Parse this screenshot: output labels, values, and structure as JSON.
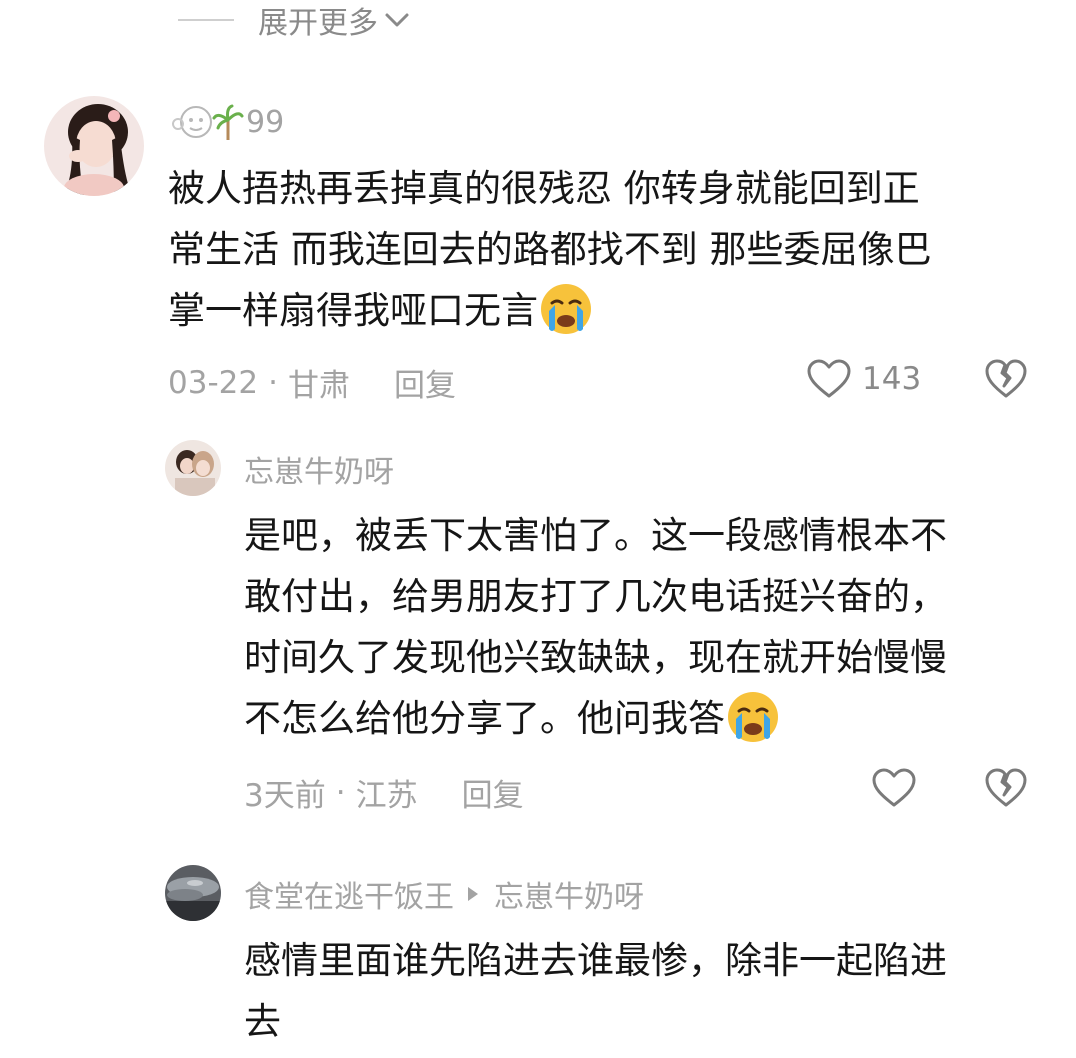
{
  "expand": {
    "label": "展开更多"
  },
  "comments": [
    {
      "username": "99",
      "text_lines": [
        "被人捂热再丢掉真的很残忍 你转身就能回到正",
        "常生活 而我连回去的路都找不到 那些委屈像巴",
        "掌一样扇得我哑口无言"
      ],
      "date": "03-22",
      "location": "甘肃",
      "reply_label": "回复",
      "likes": "143"
    },
    {
      "username": "忘崽牛奶呀",
      "text_lines": [
        "是吧，被丢下太害怕了。这一段感情根本不",
        "敢付出，给男朋友打了几次电话挺兴奋的，",
        "时间久了发现他兴致缺缺，现在就开始慢慢",
        "不怎么给他分享了。他问我答"
      ],
      "date": "3天前",
      "location": "江苏",
      "reply_label": "回复"
    },
    {
      "username": "食堂在逃干饭王",
      "reply_to": "忘崽牛奶呀",
      "text_lines": [
        "感情里面谁先陷进去谁最惨，除非一起陷进",
        "去"
      ]
    }
  ],
  "meta_separator": "·",
  "icons": {
    "chevron": "chevron-down-icon",
    "like": "heart-outline-icon",
    "dislike": "broken-heart-icon",
    "emoji": "crying-face-emoji",
    "reply_arrow": "triangle-right-icon"
  },
  "colors": {
    "text": "#161616",
    "muted": "#a3a3a3",
    "emoji_face": "#f7c23b",
    "emoji_tear": "#3fa5e6"
  }
}
